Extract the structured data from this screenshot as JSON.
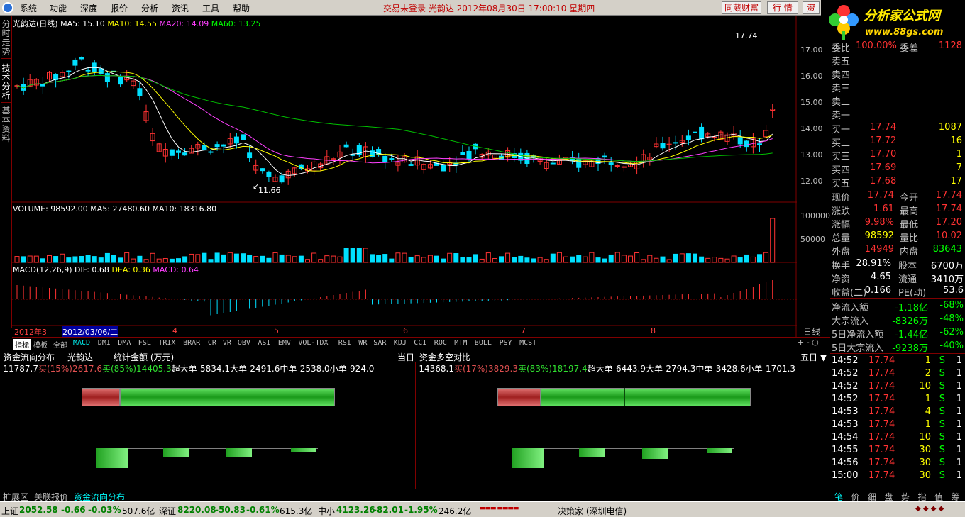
{
  "menu": {
    "items": [
      "系统",
      "功能",
      "深度",
      "报价",
      "分析",
      "资讯",
      "工具",
      "帮助"
    ],
    "status_text": "交易未登录   光韵达  2012年08月30日  17:00:10  星期四",
    "buttons": [
      "同葳财富",
      "行 情",
      "资"
    ]
  },
  "brand": {
    "name": "分析家公式网",
    "url": "www.88gs.com"
  },
  "left_tabs": [
    "分时走势",
    "技术分析",
    "基本资料"
  ],
  "kline": {
    "legend": {
      "title": "光韵达(日线)",
      "ma5": "MA5: 15.10",
      "ma10": "MA10: 14.55",
      "ma20": "MA20: 14.09",
      "ma60": "MA60: 13.25"
    },
    "price_axis": [
      "17.00",
      "16.00",
      "15.00",
      "14.00",
      "13.00",
      "12.00"
    ],
    "high_label": "17.74",
    "low_label": "11.66",
    "colors": {
      "up": "#ff3232",
      "down": "#00e0ff",
      "ma5": "#ffffff",
      "ma10": "#ffff00",
      "ma20": "#ff40ff",
      "ma60": "#00c000"
    }
  },
  "volume": {
    "legend": {
      "title": "VOLUME: 98592.00",
      "ma5": "MA5: 27480.60",
      "ma10": "MA10: 18316.80"
    },
    "axis": [
      "100000",
      "50000"
    ]
  },
  "macd": {
    "legend": {
      "title": "MACD(12,26,9)",
      "dif": "DIF: 0.68",
      "dea": "DEA: 0.36",
      "macd": "MACD: 0.64"
    }
  },
  "date_axis": {
    "labels": [
      "2012年3",
      "2012/03/06/二",
      "4",
      "5",
      "6",
      "7",
      "8"
    ],
    "period": "日线"
  },
  "indicator_tabs": [
    "指标",
    "模板",
    "全部",
    "MACD",
    "DMI",
    "DMA",
    "FSL",
    "TRIX",
    "BRAR",
    "CR",
    "VR",
    "OBV",
    "ASI",
    "EMV",
    "VOL-TDX",
    "RSI",
    "WR",
    "SAR",
    "KDJ",
    "CCI",
    "ROC",
    "MTM",
    "BOLL",
    "PSY",
    "MCST"
  ],
  "quote": {
    "code_ratio": {
      "label": "委比",
      "value": "100.00%",
      "label2": "委差",
      "value2": "1128"
    },
    "sells": [
      {
        "label": "卖五"
      },
      {
        "label": "卖四"
      },
      {
        "label": "卖三"
      },
      {
        "label": "卖二"
      },
      {
        "label": "卖一"
      }
    ],
    "buys": [
      {
        "label": "买一",
        "price": "17.74",
        "vol": "1087"
      },
      {
        "label": "买二",
        "price": "17.72",
        "vol": "16"
      },
      {
        "label": "买三",
        "price": "17.70",
        "vol": "1"
      },
      {
        "label": "买四",
        "price": "17.69",
        "vol": "7"
      },
      {
        "label": "买五",
        "price": "17.68",
        "vol": "17"
      }
    ],
    "stats": [
      {
        "l1": "现价",
        "v1": "17.74",
        "l2": "今开",
        "v2": "17.74"
      },
      {
        "l1": "涨跌",
        "v1": "1.61",
        "l2": "最高",
        "v2": "17.74"
      },
      {
        "l1": "涨幅",
        "v1": "9.98%",
        "l2": "最低",
        "v2": "17.20"
      },
      {
        "l1": "总量",
        "v1": "98592",
        "l2": "量比",
        "v2": "10.02"
      },
      {
        "l1": "外盘",
        "v1": "14949",
        "l2": "内盘",
        "v2": "83643"
      }
    ],
    "fund": [
      {
        "l1": "换手",
        "v1": "28.91%",
        "l2": "股本",
        "v2": "6700万"
      },
      {
        "l1": "净资",
        "v1": "4.65",
        "l2": "流通",
        "v2": "3410万"
      },
      {
        "l1": "收益(二)",
        "v1": "0.166",
        "l2": "PE(动)",
        "v2": "53.6"
      }
    ],
    "flow": [
      {
        "label": "净流入额",
        "value": "-1.18亿",
        "pct": "-68%"
      },
      {
        "label": "大宗流入",
        "value": "-8326万",
        "pct": "-48%"
      },
      {
        "label": "5日净流入额",
        "value": "-1.44亿",
        "pct": "-62%"
      },
      {
        "label": "5日大宗流入",
        "value": "-9238万",
        "pct": "-40%"
      }
    ],
    "ticks": [
      {
        "time": "14:52",
        "price": "17.74",
        "vol": "1",
        "side": "S",
        "n": "1"
      },
      {
        "time": "14:52",
        "price": "17.74",
        "vol": "2",
        "side": "S",
        "n": "1"
      },
      {
        "time": "14:52",
        "price": "17.74",
        "vol": "10",
        "side": "S",
        "n": "1"
      },
      {
        "time": "14:52",
        "price": "17.74",
        "vol": "1",
        "side": "S",
        "n": "1"
      },
      {
        "time": "14:53",
        "price": "17.74",
        "vol": "4",
        "side": "S",
        "n": "1"
      },
      {
        "time": "14:53",
        "price": "17.74",
        "vol": "1",
        "side": "S",
        "n": "1"
      },
      {
        "time": "14:54",
        "price": "17.74",
        "vol": "10",
        "side": "S",
        "n": "1"
      },
      {
        "time": "14:55",
        "price": "17.74",
        "vol": "30",
        "side": "S",
        "n": "1"
      },
      {
        "time": "14:56",
        "price": "17.74",
        "vol": "30",
        "side": "S",
        "n": "1"
      },
      {
        "time": "15:00",
        "price": "17.74",
        "vol": "30",
        "side": "S",
        "n": "1"
      }
    ],
    "bottom_tabs": [
      "笔",
      "价",
      "细",
      "盘",
      "势",
      "指",
      "值",
      "筹"
    ]
  },
  "fundflow": {
    "title": "资金流向分布",
    "stock": "光韵达",
    "unit": "统计金额 (万元)",
    "period_left": "当日",
    "title2": "资金多空对比",
    "period_right": "五日 ▼",
    "left": {
      "net": "-11787.7",
      "buy_label": "买(15%)",
      "buy_val": "2617.6",
      "sell_label": "卖(85%)",
      "sell_val": "14405.3",
      "buy_frac": 0.15,
      "cats": [
        {
          "name": "超大单",
          "val": "-5834.1",
          "mag": 1.0
        },
        {
          "name": "大单",
          "val": "-2491.6",
          "mag": 0.43
        },
        {
          "name": "中单",
          "val": "-2538.0",
          "mag": 0.44
        },
        {
          "name": "小单",
          "val": "-924.0",
          "mag": 0.16
        }
      ]
    },
    "right": {
      "net": "-14368.1",
      "buy_label": "买(17%)",
      "buy_val": "3829.3",
      "sell_label": "卖(83%)",
      "sell_val": "18197.4",
      "buy_frac": 0.17,
      "cats": [
        {
          "name": "超大单",
          "val": "-6443.9",
          "mag": 1.0
        },
        {
          "name": "大单",
          "val": "-2794.3",
          "mag": 0.43
        },
        {
          "name": "中单",
          "val": "-3428.6",
          "mag": 0.53
        },
        {
          "name": "小单",
          "val": "-1701.3",
          "mag": 0.26
        }
      ]
    }
  },
  "bottom_tabs": [
    "扩展区",
    "关联报价",
    "资金流向分布"
  ],
  "statusbar": {
    "sh": {
      "name": "上证",
      "value": "2052.58",
      "chg": "-0.66",
      "pct": "-0.03%",
      "amt": "507.6亿"
    },
    "sz": {
      "name": "深证",
      "value": "8220.08",
      "chg": "-50.83",
      "pct": "-0.61%",
      "amt": "615.3亿"
    },
    "zx": {
      "name": "中小",
      "value": "4123.26",
      "chg": "-82.01",
      "pct": "-1.95%",
      "amt": "246.2亿"
    },
    "server": "决策家 (深圳电信)"
  }
}
